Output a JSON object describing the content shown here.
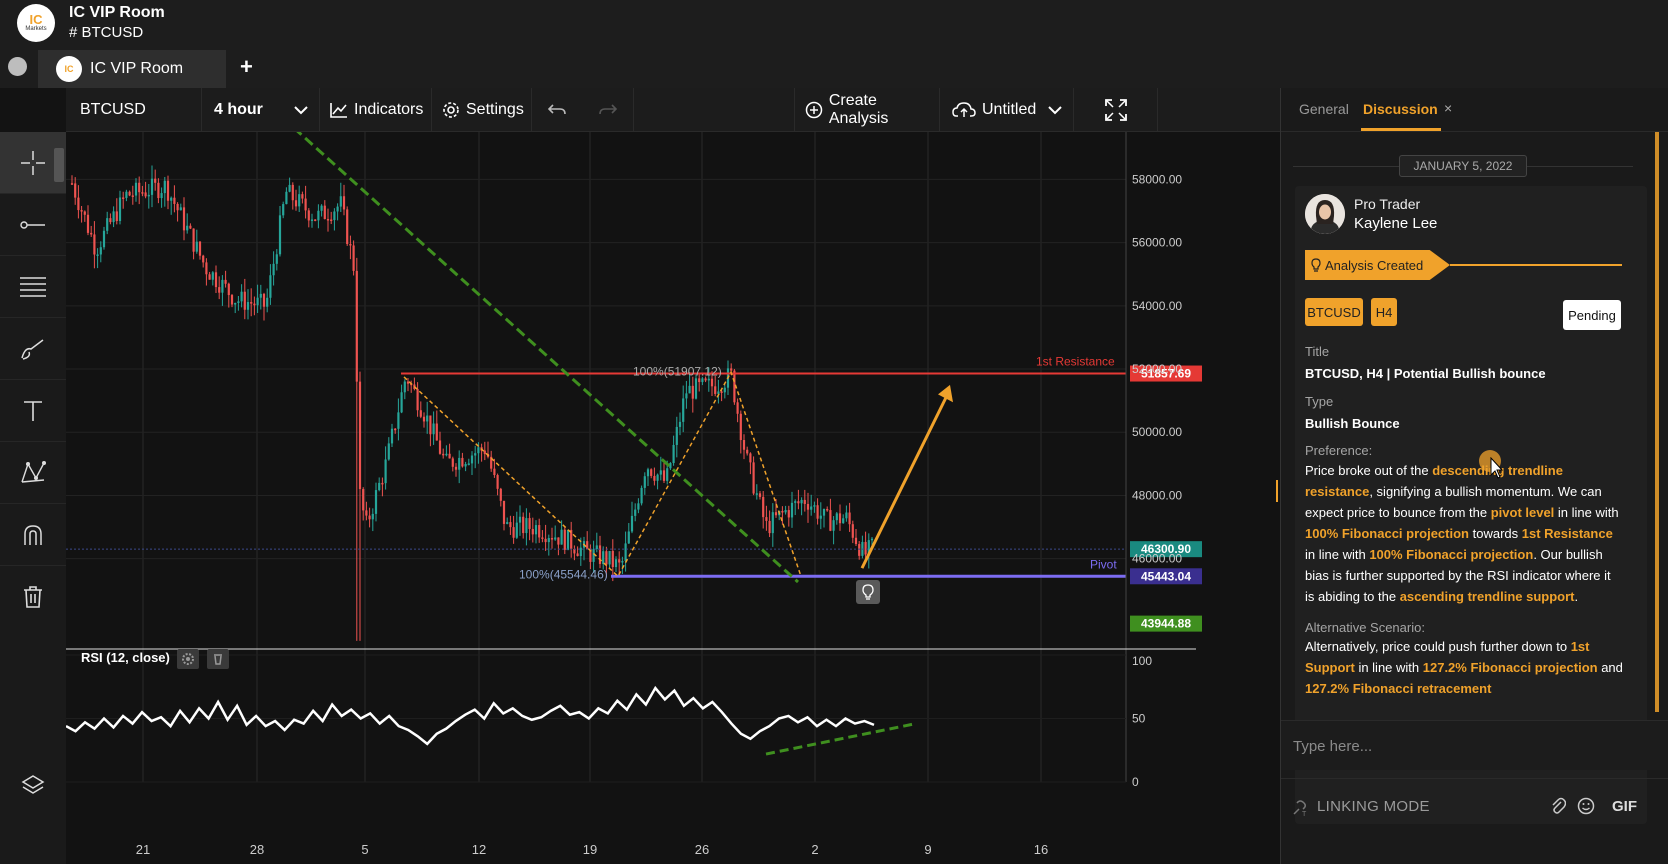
{
  "header": {
    "logo_text": "IC",
    "logo_sub": "Markets",
    "room": "IC VIP Room",
    "channel": "# BTCUSD"
  },
  "tabs": {
    "active_tab": "IC VIP Room",
    "mini_logo": "IC",
    "add": "+"
  },
  "toolbar": {
    "symbol": "BTCUSD",
    "timeframe": "4 hour",
    "indicators": "Indicators",
    "settings": "Settings",
    "create_analysis": "Create Analysis",
    "layout_name": "Untitled"
  },
  "left_tools": [
    "crosshair-icon",
    "trend-line-icon",
    "fib-retracement-icon",
    "brush-icon",
    "text-icon",
    "pattern-icon",
    "magnet-icon",
    "trash-icon",
    "layers-icon"
  ],
  "chart_data": {
    "type": "candlestick",
    "symbol": "BTCUSD",
    "timeframe": "4 hour",
    "x_ticks": [
      "21",
      "28",
      "5",
      "12",
      "19",
      "26",
      "2",
      "9",
      "16"
    ],
    "y_ticks": [
      58000.0,
      56000.0,
      54000.0,
      52000.0,
      50000.0,
      48000.0,
      46000.0
    ],
    "y_tick_labels": [
      "58000.00",
      "56000.00",
      "54000.00",
      "52000.00",
      "50000.00",
      "48000.00",
      "46000.00"
    ],
    "ylim": [
      43300,
      59500
    ],
    "price_labels": {
      "resistance": "51857.69",
      "current": "46300.90",
      "pivot": "45443.04",
      "support": "43944.88"
    },
    "annotations": {
      "resistance_label": "1st Resistance",
      "pivot_label": "Pivot",
      "fib_top": "100%(51907.12)",
      "fib_bottom": "100%(45544.46)"
    },
    "colors": {
      "bull": "#26a69a",
      "bear": "#ef5350",
      "resistance": "#e53935",
      "pivot": "#7c6cf2",
      "trendline": "#3f8f1f",
      "arrow": "#f0a22b"
    },
    "indicator": {
      "name": "RSI (12, close)",
      "y_ticks": [
        100,
        50,
        0
      ],
      "values": [
        44,
        40,
        47,
        42,
        50,
        43,
        52,
        46,
        55,
        48,
        51,
        44,
        56,
        47,
        58,
        50,
        63,
        49,
        60,
        45,
        52,
        44,
        48,
        41,
        49,
        46,
        56,
        48,
        61,
        52,
        57,
        50,
        54,
        46,
        52,
        44,
        41,
        36,
        30,
        38,
        42,
        48,
        53,
        57,
        50,
        62,
        54,
        58,
        52,
        49,
        51,
        56,
        60,
        53,
        55,
        50,
        58,
        54,
        64,
        57,
        69,
        61,
        74,
        65,
        72,
        60,
        66,
        58,
        63,
        55,
        46,
        38,
        34,
        40,
        44,
        50,
        52,
        47,
        51,
        44,
        49,
        44,
        50,
        46,
        48,
        45
      ]
    }
  },
  "discussion": {
    "tab_general": "General",
    "tab_discussion": "Discussion",
    "close": "×",
    "date": "JANUARY 5, 2022",
    "author_role": "Pro Trader",
    "author_name": "Kaylene Lee",
    "ribbon": "Analysis Created",
    "tags": [
      "BTCUSD",
      "H4"
    ],
    "status": "Pending",
    "title_label": "Title",
    "title_value": "BTCUSD, H4 | Potential Bullish bounce",
    "type_label": "Type",
    "type_value": "Bullish Bounce",
    "preference_label": "Preference:",
    "preference_segments": [
      {
        "t": "Price broke out of the ",
        "h": false
      },
      {
        "t": "descending trendline resistance",
        "h": true
      },
      {
        "t": ", signifying a bullish momentum. We can expect price to bounce from the ",
        "h": false
      },
      {
        "t": "pivot level",
        "h": true
      },
      {
        "t": " in line with ",
        "h": false
      },
      {
        "t": "100% Fibonacci projection",
        "h": true
      },
      {
        "t": " towards ",
        "h": false
      },
      {
        "t": "1st Resistance",
        "h": true
      },
      {
        "t": " in line with ",
        "h": false
      },
      {
        "t": "100% Fibonacci projection",
        "h": true
      },
      {
        "t": ". Our bullish bias is further supported by the RSI indicator where it is abiding to the ",
        "h": false
      },
      {
        "t": "ascending trendline support",
        "h": true
      },
      {
        "t": ".",
        "h": false
      }
    ],
    "alt_label": "Alternative Scenario:",
    "alt_segments": [
      {
        "t": "Alternatively, price could push further down to ",
        "h": false
      },
      {
        "t": "1st Support",
        "h": true
      },
      {
        "t": " in line with ",
        "h": false
      },
      {
        "t": "127.2% Fibonacci projection",
        "h": true
      },
      {
        "t": " and ",
        "h": false
      },
      {
        "t": "127.2% Fibonacci retracement",
        "h": true
      }
    ],
    "input_placeholder": "Type here...",
    "linking_mode": "LINKING MODE",
    "gif": "GIF"
  }
}
